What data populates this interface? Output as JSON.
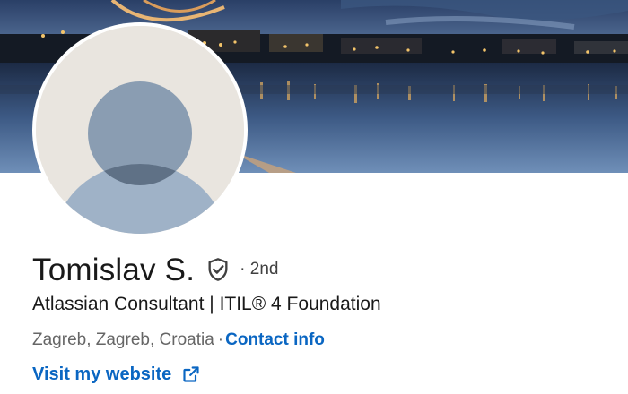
{
  "profile": {
    "name": "Tomislav S.",
    "connection_degree": "· 2nd",
    "headline": "Atlassian Consultant | ITIL® 4 Foundation",
    "location": "Zagreb, Zagreb, Croatia",
    "separator": "·",
    "contact_info_label": "Contact info",
    "website_label": "Visit my website"
  },
  "icons": {
    "verified": "shield-check-icon",
    "external_link": "external-link-icon",
    "avatar": "default-person-avatar"
  },
  "colors": {
    "link": "#0a66c2",
    "name_text": "#191919",
    "muted_text": "#666666",
    "avatar_bg": "#e9e5df",
    "avatar_figure": "#9fb2c7"
  }
}
